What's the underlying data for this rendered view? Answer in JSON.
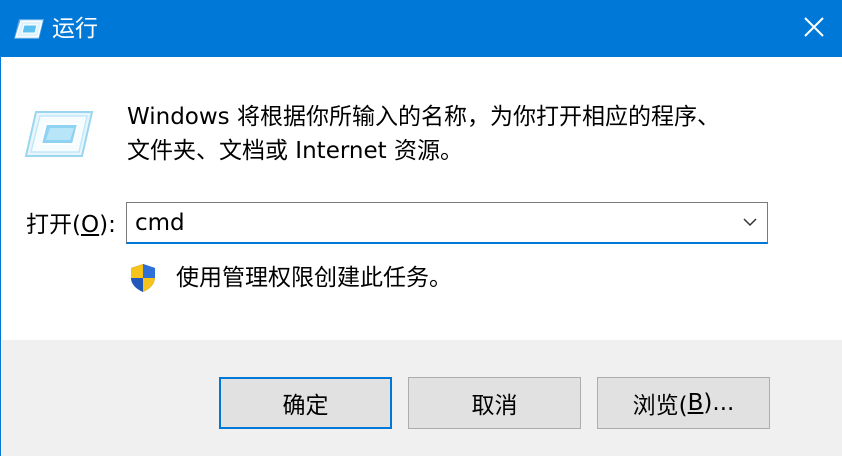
{
  "window": {
    "title": "运行"
  },
  "content": {
    "description_line1": "Windows 将根据你所输入的名称，为你打开相应的程序、",
    "description_line2": "文件夹、文档或 Internet 资源。",
    "open_label_prefix": "打开(",
    "open_label_accel": "O",
    "open_label_suffix": "):",
    "open_value": "cmd",
    "admin_note": "使用管理权限创建此任务。"
  },
  "buttons": {
    "ok": "确定",
    "cancel": "取消",
    "browse_prefix": "浏览(",
    "browse_accel": "B",
    "browse_suffix": ")..."
  },
  "colors": {
    "titlebar": "#0078d7",
    "footer": "#f0f0f0",
    "button": "#e1e1e1",
    "focus_border": "#0078d7"
  },
  "icons": {
    "title": "run-icon",
    "close": "close-icon",
    "run_large": "run-icon",
    "dropdown": "chevron-down-icon",
    "uac": "uac-shield-icon"
  }
}
